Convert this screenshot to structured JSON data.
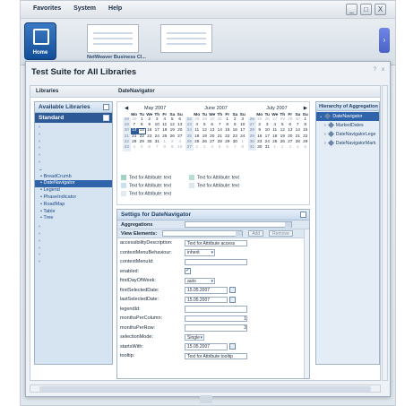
{
  "menu": [
    "Favorites",
    "System",
    "Help"
  ],
  "window_buttons": [
    "_",
    "□",
    "X"
  ],
  "launch": {
    "home_label": "Home",
    "app_label": "NetWeaver Business Cl..."
  },
  "window": {
    "title": "Test Suite for All Libraries",
    "ctrl_help": "?",
    "ctrl_close": "x"
  },
  "section_headers": {
    "left": "Libraries",
    "center": "DateNavigator"
  },
  "left_panel": {
    "title": "Available Libraries",
    "library": "Standard",
    "items": [
      "BreadCrumb",
      "DateNavigator",
      "Legend",
      "PhaseIndicator",
      "RoadMap",
      "Table",
      "Tree"
    ],
    "selected_index": 1
  },
  "calendars": [
    {
      "month": "May 2007",
      "weeks": [
        18,
        19,
        20,
        21,
        22,
        23
      ],
      "rows": [
        [
          "30",
          "1",
          "2",
          "3",
          "4",
          "5",
          "6"
        ],
        [
          "7",
          "8",
          "9",
          "10",
          "11",
          "12",
          "13"
        ],
        [
          "14",
          "15",
          "16",
          "17",
          "18",
          "19",
          "20"
        ],
        [
          "21",
          "22",
          "23",
          "24",
          "25",
          "26",
          "27"
        ],
        [
          "28",
          "29",
          "30",
          "31",
          "1",
          "2",
          "3"
        ],
        [
          "4",
          "5",
          "6",
          "7",
          "8",
          "9",
          "10"
        ]
      ]
    },
    {
      "month": "June 2007",
      "weeks": [
        22,
        23,
        24,
        25,
        26,
        27
      ],
      "rows": [
        [
          "28",
          "29",
          "30",
          "31",
          "1",
          "2",
          "3"
        ],
        [
          "4",
          "5",
          "6",
          "7",
          "8",
          "9",
          "10"
        ],
        [
          "11",
          "12",
          "13",
          "14",
          "15",
          "16",
          "17"
        ],
        [
          "18",
          "19",
          "20",
          "21",
          "22",
          "23",
          "24"
        ],
        [
          "25",
          "26",
          "27",
          "28",
          "29",
          "30",
          "1"
        ],
        [
          "2",
          "3",
          "4",
          "5",
          "6",
          "7",
          "8"
        ]
      ]
    },
    {
      "month": "July 2007",
      "weeks": [
        26,
        27,
        28,
        29,
        30,
        31
      ],
      "rows": [
        [
          "25",
          "26",
          "27",
          "28",
          "29",
          "30",
          "1"
        ],
        [
          "2",
          "3",
          "4",
          "5",
          "6",
          "7",
          "8"
        ],
        [
          "9",
          "10",
          "11",
          "12",
          "13",
          "14",
          "15"
        ],
        [
          "16",
          "17",
          "18",
          "19",
          "20",
          "21",
          "22"
        ],
        [
          "23",
          "24",
          "25",
          "26",
          "27",
          "28",
          "29"
        ],
        [
          "30",
          "31",
          "1",
          "2",
          "3",
          "4",
          "5"
        ]
      ]
    }
  ],
  "weekday_header": [
    "Mo",
    "Tu",
    "We",
    "Th",
    "Fr",
    "Sa",
    "Su"
  ],
  "legend": [
    "Text for Attribute: text",
    "Text for Attribute: text",
    "Text for Attribute: text",
    "Text for Attribute: text",
    "Text for Attribute: text"
  ],
  "settings": {
    "title": "Settigs for DateNavigator",
    "aggregations_label": "Aggregations",
    "view_elements_label": "View Elements:",
    "add_label": "Add",
    "remove_label": "Remove",
    "rows": [
      {
        "label": "accessibilityDescription:",
        "value": "Text for Attribute access"
      },
      {
        "label": "contextMenuBehaviour:",
        "value": "inherit"
      },
      {
        "label": "contextMenuId:",
        "value": ""
      },
      {
        "label": "enabled:",
        "value": "✓"
      },
      {
        "label": "firstDayOfWeek:",
        "value": "auto"
      },
      {
        "label": "firstSelectedDate:",
        "value": "15.05.2007"
      },
      {
        "label": "lastSelectedDate:",
        "value": "15.05.2007"
      },
      {
        "label": "legendId:",
        "value": ""
      },
      {
        "label": "monthsPerColumn:",
        "value": "1"
      },
      {
        "label": "monthsPerRow:",
        "value": "3"
      },
      {
        "label": "selectionMode:",
        "value": "Single"
      },
      {
        "label": "startsWith:",
        "value": "15.05.2007"
      },
      {
        "label": "tooltip:",
        "value": "Text for Attribute tooltip"
      }
    ]
  },
  "right_panel": {
    "title": "Hierarchy of Aggregation",
    "items": [
      "DateNavigator",
      "MarkedDates",
      "DateNavigatorLege",
      "DateNavigatorMark"
    ]
  },
  "colors": {
    "accent": "#2d5a97",
    "legend1": "#9fd2c4",
    "legend2": "#b7ddd0",
    "legend3": "#c7e3f2"
  }
}
